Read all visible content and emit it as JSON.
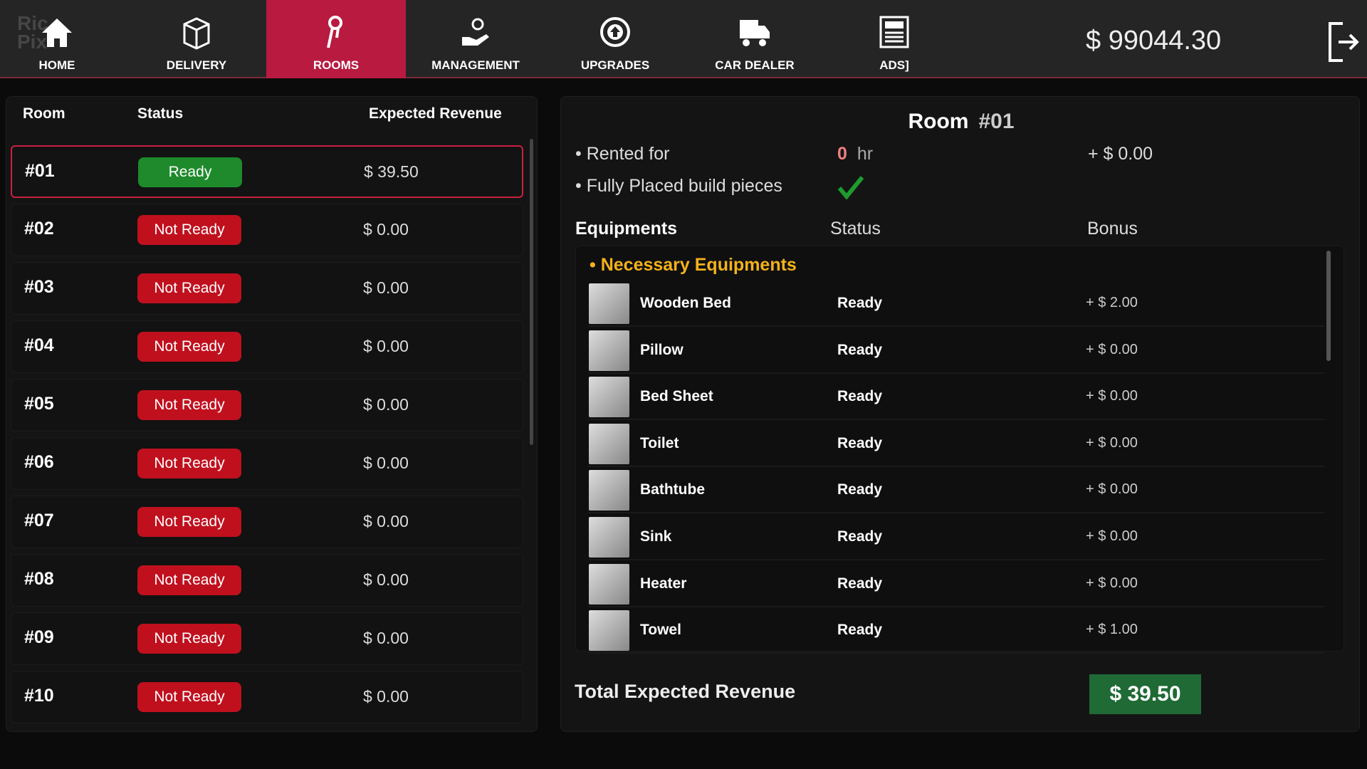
{
  "nav": {
    "logo": "Ric Pix",
    "items": [
      {
        "label": "HOME",
        "icon": "home-icon"
      },
      {
        "label": "DELIVERY",
        "icon": "box-icon"
      },
      {
        "label": "ROOMS",
        "icon": "keys-icon",
        "active": true
      },
      {
        "label": "MANAGEMENT",
        "icon": "hand-gear-icon"
      },
      {
        "label": "UPGRADES",
        "icon": "upgrade-arrow-icon"
      },
      {
        "label": "CAR DEALER",
        "icon": "truck-icon"
      },
      {
        "label": "ADS]",
        "icon": "newspaper-ads-icon"
      }
    ],
    "money": "$ 99044.30",
    "active_color": "#b81a40"
  },
  "rooms": {
    "headers": {
      "room": "Room",
      "status": "Status",
      "revenue": "Expected Revenue"
    },
    "rows": [
      {
        "room": "#01",
        "status": "Ready",
        "revenue": "$ 39.50",
        "ready": true
      },
      {
        "room": "#02",
        "status": "Not Ready",
        "revenue": "$ 0.00"
      },
      {
        "room": "#03",
        "status": "Not Ready",
        "revenue": "$ 0.00"
      },
      {
        "room": "#04",
        "status": "Not Ready",
        "revenue": "$ 0.00"
      },
      {
        "room": "#05",
        "status": "Not Ready",
        "revenue": "$ 0.00"
      },
      {
        "room": "#06",
        "status": "Not Ready",
        "revenue": "$ 0.00"
      },
      {
        "room": "#07",
        "status": "Not Ready",
        "revenue": "$ 0.00"
      },
      {
        "room": "#08",
        "status": "Not Ready",
        "revenue": "$ 0.00"
      },
      {
        "room": "#09",
        "status": "Not Ready",
        "revenue": "$ 0.00"
      },
      {
        "room": "#10",
        "status": "Not Ready",
        "revenue": "$ 0.00"
      }
    ]
  },
  "detail": {
    "title": "Room",
    "number": "#01",
    "rented_label": "Rented for",
    "rented_value": "0",
    "rented_unit": "hr",
    "rented_bonus": "+ $ 0.00",
    "placed_label": "Fully Placed build pieces",
    "eq_header": "Equipments",
    "status_header": "Status",
    "bonus_header": "Bonus",
    "section": "Necessary Equipments",
    "items": [
      {
        "name": "Wooden Bed",
        "status": "Ready",
        "bonus": "+ $ 2.00"
      },
      {
        "name": "Pillow",
        "status": "Ready",
        "bonus": "+ $ 0.00"
      },
      {
        "name": "Bed Sheet",
        "status": "Ready",
        "bonus": "+ $ 0.00"
      },
      {
        "name": "Toilet",
        "status": "Ready",
        "bonus": "+ $ 0.00"
      },
      {
        "name": "Bathtube",
        "status": "Ready",
        "bonus": "+ $ 0.00"
      },
      {
        "name": "Sink",
        "status": "Ready",
        "bonus": "+ $ 0.00"
      },
      {
        "name": "Heater",
        "status": "Ready",
        "bonus": "+ $ 0.00"
      },
      {
        "name": "Towel",
        "status": "Ready",
        "bonus": "+ $ 1.00"
      }
    ],
    "total_label": "Total Expected Revenue",
    "total_value": "$ 39.50"
  }
}
